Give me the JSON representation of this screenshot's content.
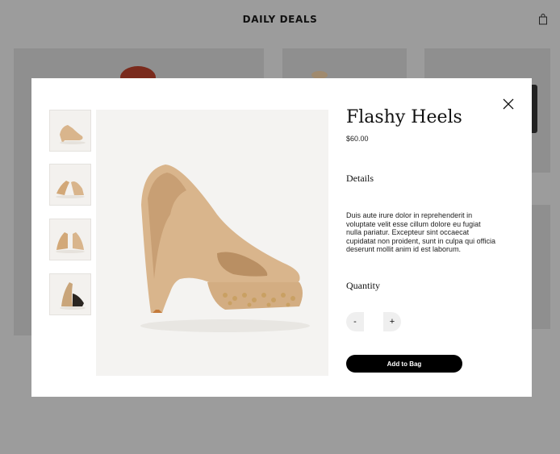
{
  "header": {
    "site_title": "DAILY DEALS",
    "cart_icon": "shopping-bag-icon"
  },
  "modal": {
    "close_icon": "close-icon",
    "product": {
      "title": "Flashy Heels",
      "price": "$60.00"
    },
    "thumbnails": [
      {
        "alt": "shoe side view",
        "selected": true
      },
      {
        "alt": "pair front view",
        "selected": false
      },
      {
        "alt": "pair back view",
        "selected": false
      },
      {
        "alt": "shoe angled view",
        "selected": false
      }
    ],
    "details": {
      "heading": "Details",
      "text": "Duis aute irure dolor in reprehenderit in voluptate velit esse cillum dolore eu fugiat nulla pariatur. Excepteur sint occaecat cupidatat non proident, sunt in culpa qui officia deserunt mollit anim id est laborum."
    },
    "quantity": {
      "heading": "Quantity",
      "minus_label": "-",
      "plus_label": "+",
      "value": ""
    },
    "add_to_bag_label": "Add to Bag"
  },
  "colors": {
    "overlay": "#9c9c9c",
    "modal_bg": "#ffffff",
    "button_bg": "#000000",
    "button_text": "#ffffff",
    "shoe_tan": "#d9b58c"
  }
}
